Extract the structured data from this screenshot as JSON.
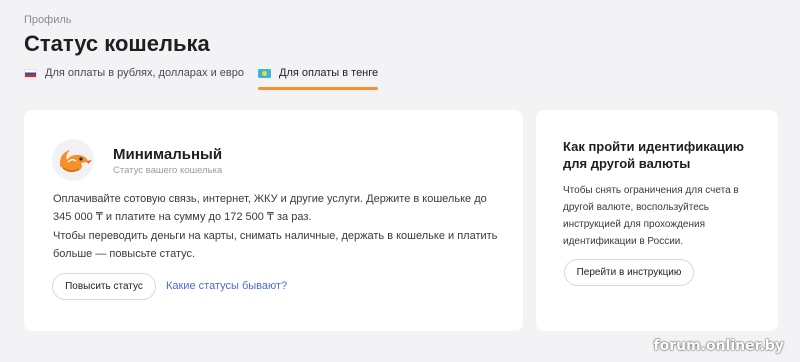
{
  "breadcrumb": "Профиль",
  "page_title": "Статус кошелька",
  "tabs": [
    {
      "label": "Для оплаты в рублях, долларах и евро",
      "flag": "ru-flag-icon",
      "active": false
    },
    {
      "label": "Для оплаты в тенге",
      "flag": "kz-flag-icon",
      "active": true
    }
  ],
  "status_card": {
    "icon": "bird-status-icon",
    "title": "Минимальный",
    "subtitle": "Статус вашего кошелька",
    "paragraph_1": "Оплачивайте сотовую связь, интернет, ЖКУ и другие услуги. Держите в кошельке до 345 000 ₸ и платите на сумму до 172 500 ₸ за раз.",
    "paragraph_2": "Чтобы переводить деньги на карты, снимать наличные, держать в кошельке и платить больше — повысьте статус.",
    "raise_button": "Повысить статус",
    "statuses_link": "Какие статусы бывают?"
  },
  "side_card": {
    "title": "Как пройти идентификацию для другой валюты",
    "text": "Чтобы снять ограничения для счета в другой валюте, воспользуйтесь инструкцией для прохождения идентификации в России.",
    "button": "Перейти в инструкцию"
  },
  "watermark": "forum.onliner.by",
  "colors": {
    "accent": "#f4912a",
    "link": "#4d6bd6",
    "background": "#f3f3f6"
  }
}
